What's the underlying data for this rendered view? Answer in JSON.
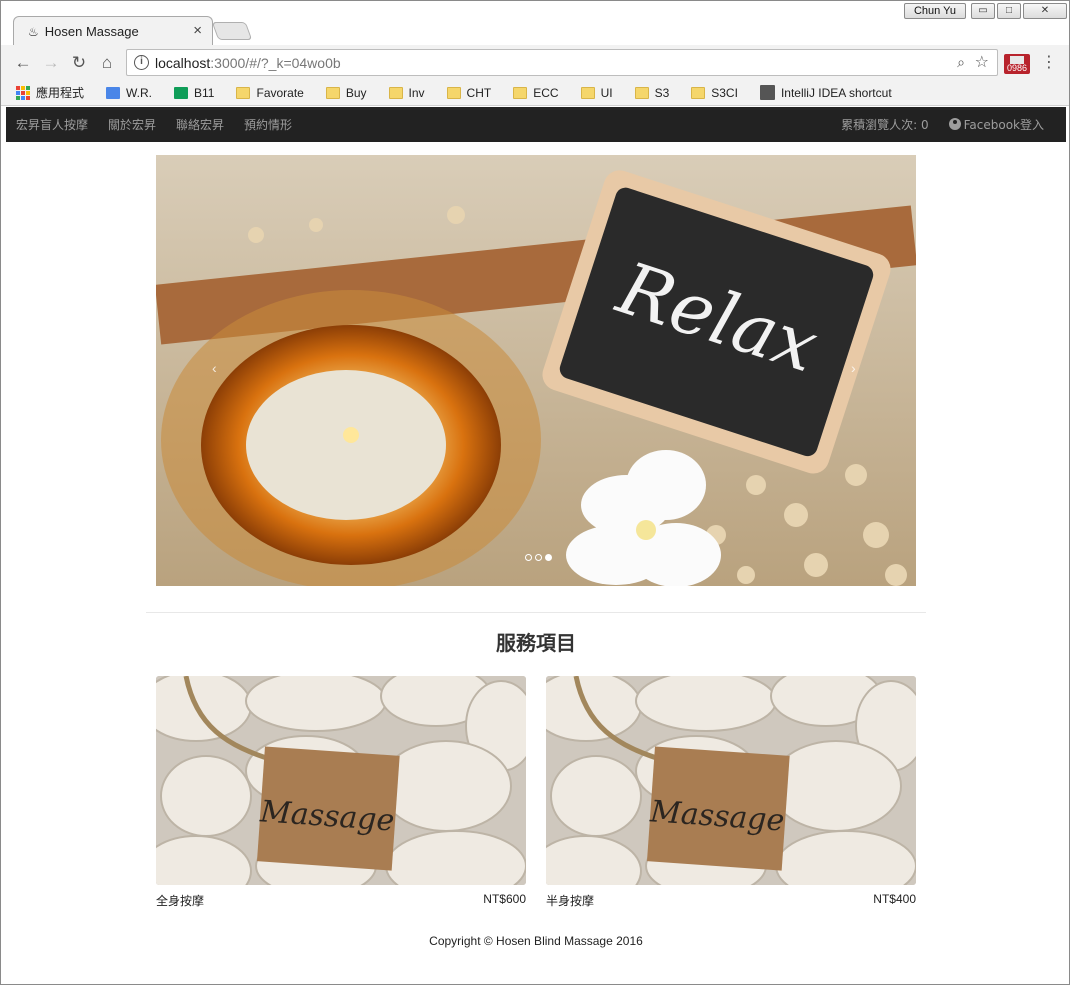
{
  "browser": {
    "tab_title": "Hosen Massage",
    "tab_close": "×",
    "user_name": "Chun Yu",
    "url_host": "localhost",
    "url_rest": ":3000/#/?_k=04wo0b",
    "ext_badge": "0986",
    "bookmarks": [
      {
        "label": "應用程式",
        "icon": "apps-icon"
      },
      {
        "label": "W.R.",
        "icon": "docs-icon"
      },
      {
        "label": "B11",
        "icon": "sheets-icon"
      },
      {
        "label": "Favorate",
        "icon": "folder-icon"
      },
      {
        "label": "Buy",
        "icon": "folder-icon"
      },
      {
        "label": "Inv",
        "icon": "folder-icon"
      },
      {
        "label": "CHT",
        "icon": "folder-icon"
      },
      {
        "label": "ECC",
        "icon": "folder-icon"
      },
      {
        "label": "UI",
        "icon": "folder-icon"
      },
      {
        "label": "S3",
        "icon": "folder-icon"
      },
      {
        "label": "S3CI",
        "icon": "folder-icon"
      },
      {
        "label": "IntelliJ IDEA shortcut",
        "icon": "intellij-icon"
      }
    ]
  },
  "navbar": {
    "brand": "宏昇盲人按摩",
    "links": [
      "關於宏昇",
      "聯絡宏昇",
      "預約情形"
    ],
    "visits": "累積瀏覽人次: 0",
    "login": "Facebook登入"
  },
  "carousel": {
    "sign_text": "Relax",
    "prev": "‹",
    "next": "›",
    "slide_count": 3,
    "active_slide": 3
  },
  "services": {
    "title": "服務項目",
    "items": [
      {
        "name": "全身按摩",
        "price": "NT$600",
        "tag_text": "Massage"
      },
      {
        "name": "半身按摩",
        "price": "NT$400",
        "tag_text": "Massage"
      }
    ]
  },
  "footer": {
    "copyright": "Copyright © Hosen Blind Massage 2016"
  }
}
